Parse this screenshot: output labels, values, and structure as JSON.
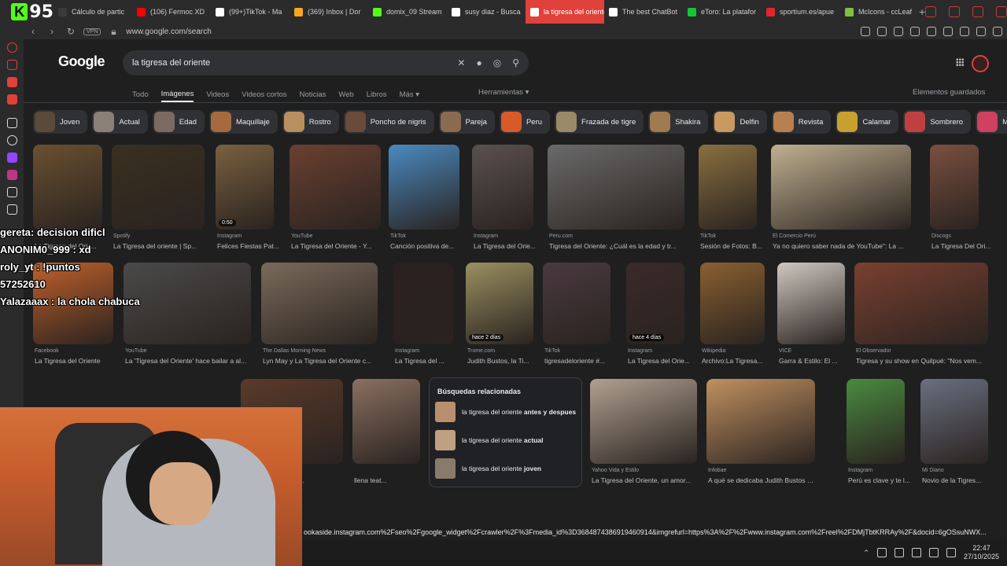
{
  "browser": {
    "logo_text": "95",
    "tabs": [
      {
        "label": "Cálculo de partic",
        "color": "#3a3a3a"
      },
      {
        "label": "(106) Fermoc XD",
        "color": "#ff0000"
      },
      {
        "label": "(99+)TikTok - Ma",
        "color": "#ffffff"
      },
      {
        "label": "(369) Inbox | Dor",
        "color": "#f5a623"
      },
      {
        "label": "domix_09 Stream",
        "color": "#53fc18"
      },
      {
        "label": "susy diaz - Busca",
        "color": "#ffffff"
      },
      {
        "label": "la tigresa del oriente - Bu",
        "color": "#ffffff",
        "active": true
      },
      {
        "label": "The best ChatBot",
        "color": "#ffffff"
      },
      {
        "label": "eToro: La platafor",
        "color": "#13c636"
      },
      {
        "label": "sportium.es/apue",
        "color": "#e3262d"
      },
      {
        "label": "McIcons - ccLeaf",
        "color": "#7cc242"
      }
    ],
    "new_tab": "+",
    "vpn_label": "VPN",
    "url": "www.google.com/search",
    "status_url": "ookaside.instagram.com%2Fseo%2Fgoogle_widget%2Fcrawler%2F%3Fmedia_id%3D3684874386919460914&imgrefurl=https%3A%2F%2Fwww.instagram.com%2Freel%2FDMjTbtKRRAy%2F&docid=6gOSsuNWX..."
  },
  "google": {
    "logo": "Google",
    "query": "la tigresa del oriente",
    "tabs": [
      "Todo",
      "Imágenes",
      "Videos",
      "Videos cortos",
      "Noticias",
      "Web",
      "Libros",
      "Más ▾"
    ],
    "selected_tab": 1,
    "tools": "Herramientas ▾",
    "saved": "Elementos guardados",
    "chips": [
      {
        "label": "Joven",
        "color": "#5a4a3a"
      },
      {
        "label": "Actual",
        "color": "#8a8078"
      },
      {
        "label": "Edad",
        "color": "#7a6a60"
      },
      {
        "label": "Maquillaje",
        "color": "#a56a40"
      },
      {
        "label": "Rostro",
        "color": "#b89060"
      },
      {
        "label": "Poncho de nigris",
        "color": "#6a4a3a"
      },
      {
        "label": "Pareja",
        "color": "#8a6a50"
      },
      {
        "label": "Peru",
        "color": "#d85a28"
      },
      {
        "label": "Frazada de tigre",
        "color": "#9a8a6a"
      },
      {
        "label": "Shakira",
        "color": "#a07a50"
      },
      {
        "label": "Delfin",
        "color": "#c89a60"
      },
      {
        "label": "Revista",
        "color": "#b88050"
      },
      {
        "label": "Calamar",
        "color": "#c8a030"
      },
      {
        "label": "Sombrero",
        "color": "#c04040"
      },
      {
        "label": "Mexic",
        "color": "#d04060"
      }
    ],
    "row1": [
      {
        "src": "",
        "cap": "La Tigresa del Orie...",
        "color": "#6a5030"
      },
      {
        "src": "Spotify",
        "cap": "La Tigresa del oriente | Sp...",
        "color": "#3a3020"
      },
      {
        "src": "Instagram",
        "cap": "Felices Fiestas Pat...",
        "color": "#7a6040",
        "dur": "0:50"
      },
      {
        "src": "YouTube",
        "cap": "La Tigresa del Oriente - Y...",
        "color": "#6a4030"
      },
      {
        "src": "TikTok",
        "cap": "Canción positiva de...",
        "color": "#4a8ac0"
      },
      {
        "src": "Instagram",
        "cap": "La Tigresa del Orie...",
        "color": "#5a5050"
      },
      {
        "src": "Peru.com",
        "cap": "Tigresa del Oriente: ¿Cuál es la edad y tr...",
        "color": "#6a6a6a"
      },
      {
        "src": "TikTok",
        "cap": "Sesión de Fotos: B...",
        "color": "#8a7040"
      },
      {
        "src": "El Comercio Perú",
        "cap": "Ya no quiero saber nada de YouTube\": La ...",
        "color": "#c0b090"
      },
      {
        "src": "Discogs",
        "cap": "La Tigresa Del Ori...",
        "color": "#7a5040"
      }
    ],
    "row2": [
      {
        "src": "Facebook",
        "cap": "La Tigresa del Oriente",
        "color": "#c0602a"
      },
      {
        "src": "YouTube",
        "cap": "La 'Tigresa del Oriente' hace bailar a al...",
        "color": "#4a4a4a"
      },
      {
        "src": "The Dallas Morning News",
        "cap": "Lyn May y La Tigresa del Oriente c...",
        "color": "#7a6a5a"
      },
      {
        "src": "Instagram",
        "cap": "La Tigresa del ...",
        "color": "#2a2020"
      },
      {
        "src": "Trome.com",
        "cap": "Judith Bustos, la Ti...",
        "color": "#9a9060",
        "dur": "hace 2 días"
      },
      {
        "src": "TikTok",
        "cap": "tigresadeloriente #...",
        "color": "#4a3a40"
      },
      {
        "src": "Instagram",
        "cap": "La Tigresa del Orie...",
        "color": "#3a2a2a",
        "dur": "hace 4 días"
      },
      {
        "src": "Wikipedia",
        "cap": "Archivo:La Tigresa...",
        "color": "#8a6030"
      },
      {
        "src": "VICE",
        "cap": "Garra & Estilo: El ...",
        "color": "#d0c8c0"
      },
      {
        "src": "El Observador",
        "cap": "Tigresa y su show en Quilpué: \"Nos vem...",
        "color": "#7a4030"
      }
    ],
    "row3": [
      {
        "src": "Facebook",
        "cap": "La Tigresa del Orie...",
        "color": "#5a3a2a"
      },
      {
        "src": "",
        "cap": "llena teat...",
        "color": "#8a7060"
      },
      {
        "src": "Yahoo Vida y Estilo",
        "cap": "La Tigresa del Oriente, un amor...",
        "color": "#b0a090"
      },
      {
        "src": "Infobae",
        "cap": "A qué se dedicaba Judith Bustos ante...",
        "color": "#c09060"
      },
      {
        "src": "Instagram",
        "cap": "Perú es clave y te l...",
        "color": "#4a8a40"
      },
      {
        "src": "Mi Diario",
        "cap": "Novio de la Tigres...",
        "color": "#6a7080"
      }
    ],
    "related": {
      "title": "Búsquedas relacionadas",
      "items": [
        {
          "prefix": "la tigresa del oriente ",
          "bold": "antes y despues"
        },
        {
          "prefix": "la tigresa del oriente ",
          "bold": "actual"
        },
        {
          "prefix": "la tigresa del oriente ",
          "bold": "joven"
        }
      ]
    }
  },
  "chat": [
    "gereta: decision dificl",
    "ANONIM0_999 : xd",
    "roly_yt : !puntos",
    "57252610",
    "Yalazaaax : la chola chabuca"
  ],
  "taskbar": {
    "time": "22:47",
    "date": "27/10/2025"
  }
}
